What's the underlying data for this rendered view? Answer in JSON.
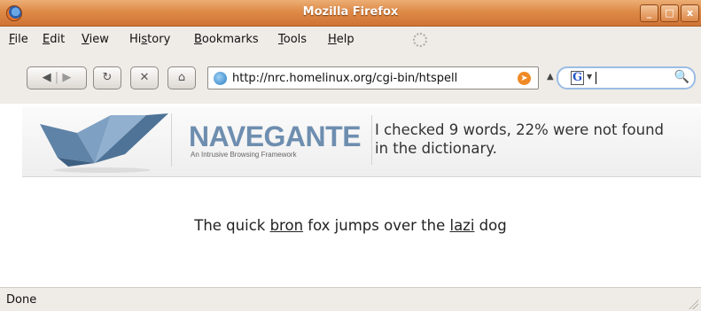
{
  "window": {
    "title": "Mozilla Firefox"
  },
  "menu": [
    {
      "pre": "",
      "u": "F",
      "post": "ile"
    },
    {
      "pre": "",
      "u": "E",
      "post": "dit"
    },
    {
      "pre": "",
      "u": "V",
      "post": "iew"
    },
    {
      "pre": "Hi",
      "u": "s",
      "post": "tory"
    },
    {
      "pre": "",
      "u": "B",
      "post": "ookmarks"
    },
    {
      "pre": "",
      "u": "T",
      "post": "ools"
    },
    {
      "pre": "",
      "u": "H",
      "post": "elp"
    }
  ],
  "navbar": {
    "url": "http://nrc.homelinux.org/cgi-bin/htspell",
    "search_value": ""
  },
  "banner": {
    "brand": "NAVEGANTE",
    "tagline": "An Intrusive Browsing Framework",
    "message": "I checked 9 words, 22% were not found in the dictionary."
  },
  "sentence": {
    "part1": "The quick ",
    "bad1": "bron",
    "part2": " fox jumps over the ",
    "bad2": "lazi",
    "part3": " dog"
  },
  "status": {
    "text": "Done"
  },
  "colors": {
    "titlebar": "#de8a47",
    "brand": "#6e8eb0"
  }
}
